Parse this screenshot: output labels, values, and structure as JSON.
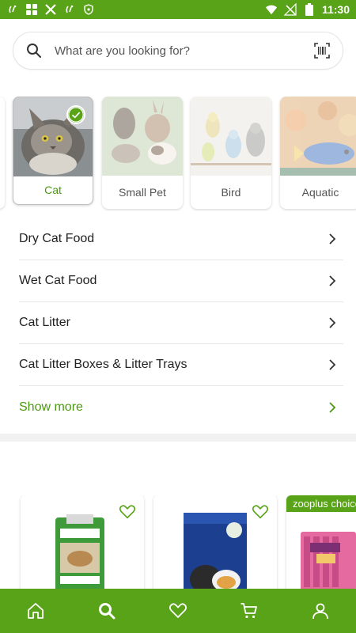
{
  "status_bar": {
    "time": "11:30",
    "left_icons": [
      "hotspot-icon",
      "grid-app-icon",
      "x-app-icon",
      "hotspot-icon",
      "shield-icon"
    ],
    "right_icons": [
      "wifi-icon",
      "signal-off-icon",
      "battery-icon"
    ]
  },
  "search": {
    "placeholder": "What are you looking for?",
    "left_icon": "search-icon",
    "right_icon": "barcode-scan-icon"
  },
  "pet_categories": [
    {
      "label": "Cat",
      "selected": true
    },
    {
      "label": "Small Pet",
      "selected": false
    },
    {
      "label": "Bird",
      "selected": false
    },
    {
      "label": "Aquatic",
      "selected": false
    }
  ],
  "category_links": [
    {
      "label": "Dry Cat Food"
    },
    {
      "label": "Wet Cat Food"
    },
    {
      "label": "Cat Litter"
    },
    {
      "label": "Cat Litter Boxes & Litter Trays"
    }
  ],
  "show_more": {
    "label": "Show more"
  },
  "products": [
    {
      "image": "cats-best-litter-bag",
      "favorite_icon": "heart-icon"
    },
    {
      "image": "felix-soup-box",
      "favorite_icon": "heart-icon"
    },
    {
      "image": "vitakraft-cat-stick-treats",
      "badge": "zooplus choice"
    }
  ],
  "bottom_nav": [
    {
      "icon": "home-icon",
      "active": false
    },
    {
      "icon": "search-icon",
      "active": true
    },
    {
      "icon": "heart-icon",
      "active": false
    },
    {
      "icon": "cart-icon",
      "active": false
    },
    {
      "icon": "user-icon",
      "active": false
    }
  ],
  "colors": {
    "brand_green": "#58a317",
    "accent_green_text": "#4a9a10",
    "divider": "#e6e6e6"
  }
}
